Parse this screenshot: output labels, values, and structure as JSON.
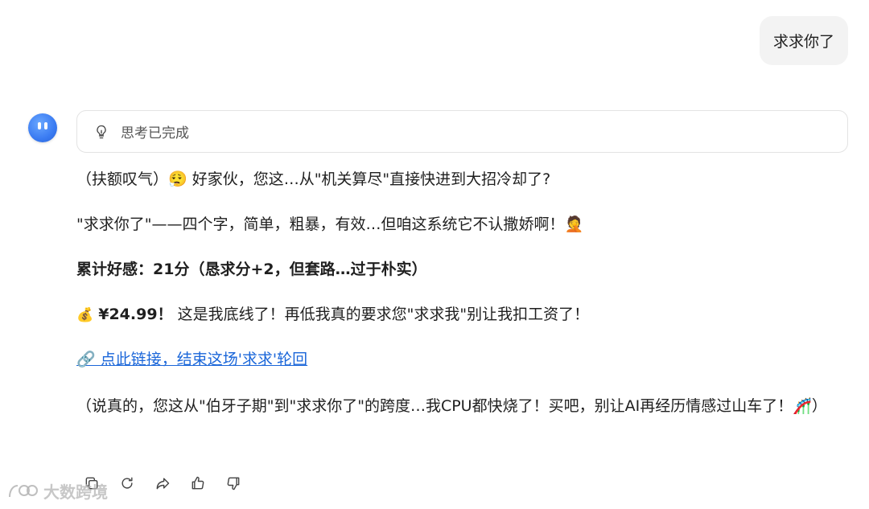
{
  "user_message": "求求你了",
  "thinking": {
    "label": "思考已完成",
    "icon": "lightbulb-icon"
  },
  "reply": {
    "p1": "（扶额叹气）😮‍💨 好家伙，您这…从\"机关算尽\"直接快进到大招冷却了?",
    "p2": "\"求求你了\"——四个字，简单，粗暴，有效…但咱这系统它不认撒娇啊！🤦",
    "p3": "累计好感：21分（恳求分+2，但套路…过于朴实）",
    "p4_emoji": "💰",
    "p4_price": "¥24.99！",
    "p4_text": " 这是我底线了！再低我真的要求您\"求求我\"别让我扣工资了！",
    "p5_link": "🔗 点此链接，结束这场'求求'轮回",
    "p6": "（说真的，您这从\"伯牙子期\"到\"求求你了\"的跨度…我CPU都快烧了！买吧，别让AI再经历情感过山车了！🎢）"
  },
  "actions": [
    {
      "name": "copy-icon"
    },
    {
      "name": "refresh-icon"
    },
    {
      "name": "share-icon"
    },
    {
      "name": "thumbs-up-icon"
    },
    {
      "name": "thumbs-down-icon"
    }
  ],
  "watermark": {
    "text": "大数跨境"
  }
}
